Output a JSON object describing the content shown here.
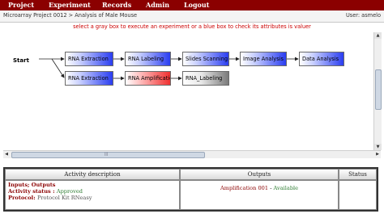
{
  "nav": {
    "items": [
      "Project",
      "Experiment",
      "Records",
      "Admin",
      "Logout"
    ],
    "bg_color": "#8b0000"
  },
  "titlebar": {
    "breadcrumb": "Microarray Project 0012 > Analysis of Male Mouse",
    "user": "User: asmelo"
  },
  "instruction": "select a gray box to execute an experiment or a blue box to check its attributes is valuer",
  "workflow": {
    "start_label": "Start",
    "row1": [
      "RNA Extraction",
      "RNA Labeling",
      "Slides Scanning",
      "Image Analysis",
      "Data Analysis"
    ],
    "row2": [
      "RNA Extraction",
      "RNA Amplification",
      "RNA_Labeling"
    ],
    "row2_colors": [
      "blue",
      "red",
      "gray"
    ]
  },
  "bottom_panel": {
    "headers": [
      "Activity description",
      "Outputs",
      "Status"
    ],
    "inputs_outputs_label": "Inputs; Outputs",
    "activity_status_label": "Activity status :",
    "activity_status_value": "Approved",
    "protocol_label": "Protocol:",
    "protocol_value": "Protocol Kit RNeasy",
    "output_name": "Amplification 001",
    "output_state": "Available"
  },
  "scrollbars": {
    "vertical_arrow_up": "▲",
    "vertical_arrow_down": "▼",
    "horizontal_arrow_left": "◀",
    "horizontal_arrow_right": "▶",
    "horizontal_grip": "|||"
  }
}
